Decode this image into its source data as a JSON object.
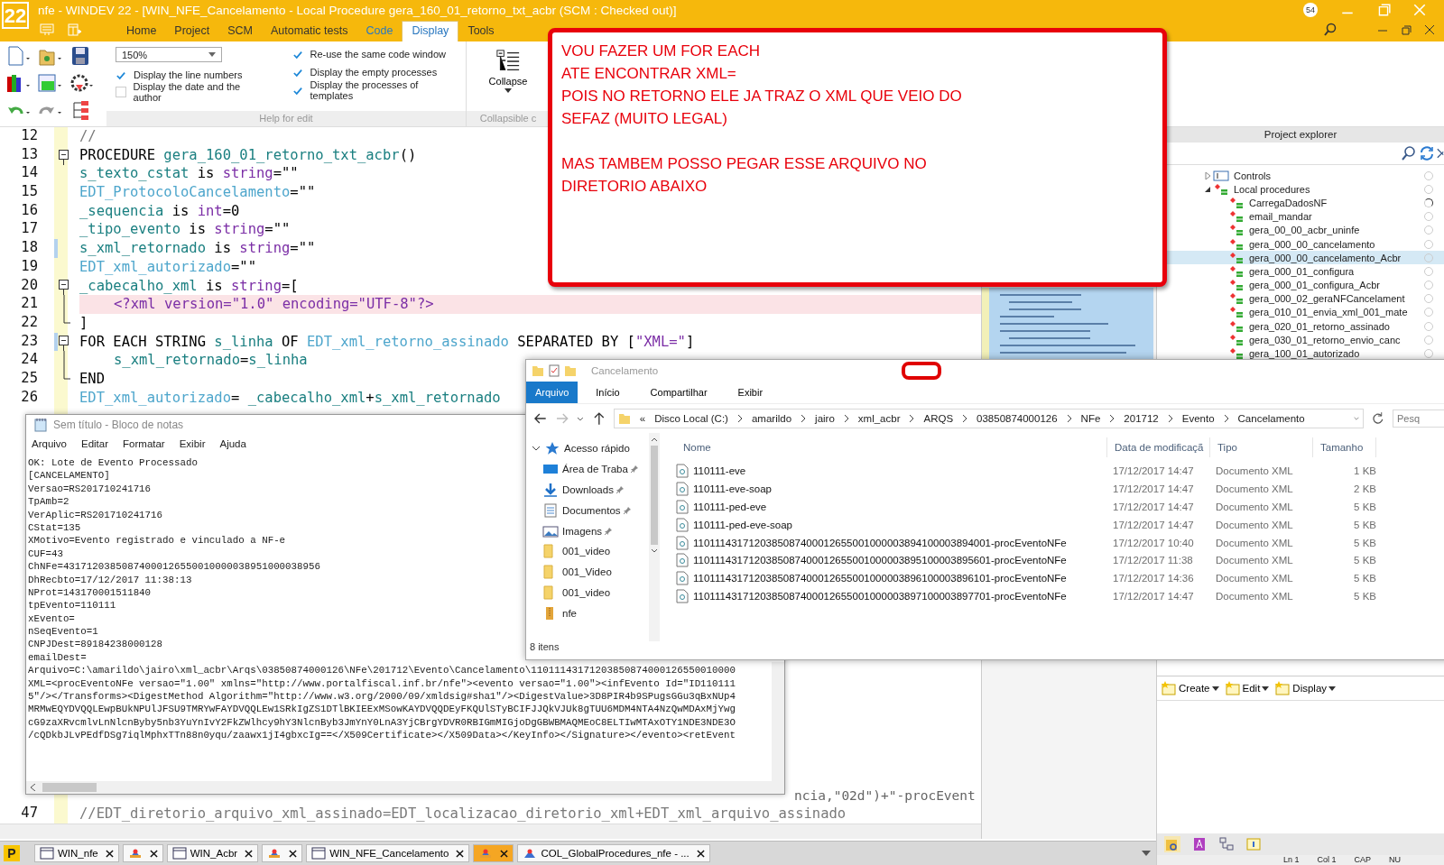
{
  "window": {
    "title": "nfe - WINDEV 22 - [WIN_NFE_Cancelamento - Local Procedure gera_160_01_retorno_txt_acbr (SCM : Checked out)]",
    "logo": "22",
    "notification_count": "54"
  },
  "ribbon_tabs": [
    {
      "label": "Home",
      "selected": false,
      "kind": "normal"
    },
    {
      "label": "Project",
      "selected": false,
      "kind": "normal"
    },
    {
      "label": "SCM",
      "selected": false,
      "kind": "normal"
    },
    {
      "label": "Automatic tests",
      "selected": false,
      "kind": "normal"
    },
    {
      "label": "Code",
      "selected": false,
      "kind": "contextual"
    },
    {
      "label": "Display",
      "selected": true,
      "kind": "normal"
    },
    {
      "label": "Tools",
      "selected": false,
      "kind": "normal"
    }
  ],
  "ribbon": {
    "zoom": "150%",
    "options": [
      {
        "label": "Display the line numbers",
        "checked": true
      },
      {
        "label": "Display the date and the author",
        "checked": false
      },
      {
        "label": "Re-use the same code window",
        "checked": true
      },
      {
        "label": "Display the empty processes",
        "checked": true
      },
      {
        "label": "Display the processes of templates",
        "checked": true
      }
    ],
    "group_label": "Help for edit",
    "collapse_label": "Collapse",
    "group2_label": "Collapsible c"
  },
  "callout": {
    "paragraphs": [
      "VOU FAZER UM FOR EACH\nATE ENCONTRAR XML=\nPOIS NO RETORNO ELE JA TRAZ O XML QUE VEIO DO\nSEFAZ (MUITO LEGAL)",
      "MAS TAMBEM POSSO PEGAR ESSE ARQUIVO NO\nDIRETORIO ABAIXO"
    ]
  },
  "code_editor": {
    "lines": [
      {
        "number": "12",
        "kind": "plain",
        "changed": false,
        "highlighted": false,
        "indent": false,
        "tokens": [
          {
            "text": "//",
            "kind": "comment"
          }
        ]
      },
      {
        "number": "13",
        "kind": "fold_start",
        "changed": false,
        "highlighted": false,
        "indent": false,
        "tokens": [
          {
            "text": "PROCEDURE ",
            "kind": "keyword"
          },
          {
            "text": "gera_160_01_retorno_txt_acbr",
            "kind": "identifier"
          },
          {
            "text": "()",
            "kind": "keyword"
          }
        ]
      },
      {
        "number": "14",
        "kind": "plain",
        "changed": false,
        "highlighted": false,
        "indent": false,
        "tokens": [
          {
            "text": "s_texto_cstat",
            "kind": "identifier"
          },
          {
            "text": " is ",
            "kind": "keyword"
          },
          {
            "text": "string",
            "kind": "type"
          },
          {
            "text": "=\"\"",
            "kind": "keyword"
          }
        ]
      },
      {
        "number": "15",
        "kind": "plain",
        "changed": false,
        "highlighted": false,
        "indent": false,
        "tokens": [
          {
            "text": "EDT_ProtocoloCancelamento",
            "kind": "control"
          },
          {
            "text": "=\"\"",
            "kind": "keyword"
          }
        ]
      },
      {
        "number": "16",
        "kind": "plain",
        "changed": false,
        "highlighted": false,
        "indent": false,
        "tokens": [
          {
            "text": "_sequencia",
            "kind": "identifier"
          },
          {
            "text": " is ",
            "kind": "keyword"
          },
          {
            "text": "int",
            "kind": "type"
          },
          {
            "text": "=0",
            "kind": "keyword"
          }
        ]
      },
      {
        "number": "17",
        "kind": "plain",
        "changed": false,
        "highlighted": false,
        "indent": false,
        "tokens": [
          {
            "text": "_tipo_evento",
            "kind": "identifier"
          },
          {
            "text": " is ",
            "kind": "keyword"
          },
          {
            "text": "string",
            "kind": "type"
          },
          {
            "text": "=\"\"",
            "kind": "keyword"
          }
        ]
      },
      {
        "number": "18",
        "kind": "plain",
        "changed": true,
        "highlighted": false,
        "indent": false,
        "tokens": [
          {
            "text": "s_xml_retornado",
            "kind": "identifier"
          },
          {
            "text": " is ",
            "kind": "keyword"
          },
          {
            "text": "string",
            "kind": "type"
          },
          {
            "text": "=\"\"",
            "kind": "keyword"
          }
        ]
      },
      {
        "number": "19",
        "kind": "plain",
        "changed": false,
        "highlighted": false,
        "indent": false,
        "tokens": [
          {
            "text": "EDT_xml_autorizado",
            "kind": "control"
          },
          {
            "text": "=\"\"",
            "kind": "keyword"
          }
        ]
      },
      {
        "number": "20",
        "kind": "fold_start",
        "changed": false,
        "highlighted": false,
        "indent": false,
        "tokens": [
          {
            "text": "_cabecalho_xml",
            "kind": "identifier"
          },
          {
            "text": " is ",
            "kind": "keyword"
          },
          {
            "text": "string",
            "kind": "type"
          },
          {
            "text": "=[",
            "kind": "keyword"
          }
        ]
      },
      {
        "number": "21",
        "kind": "fold_mid",
        "changed": false,
        "highlighted": true,
        "indent": true,
        "tokens": [
          {
            "text": "<?xml version=\"1.0\" encoding=\"UTF-8\"?>",
            "kind": "string"
          }
        ]
      },
      {
        "number": "22",
        "kind": "fold_end",
        "changed": false,
        "highlighted": false,
        "indent": false,
        "tokens": [
          {
            "text": "]",
            "kind": "keyword"
          }
        ]
      },
      {
        "number": "23",
        "kind": "fold_start",
        "changed": true,
        "highlighted": false,
        "indent": false,
        "tokens": [
          {
            "text": "FOR EACH STRING ",
            "kind": "keyword"
          },
          {
            "text": "s_linha",
            "kind": "identifier"
          },
          {
            "text": " OF ",
            "kind": "keyword"
          },
          {
            "text": "EDT_xml_retorno_assinado",
            "kind": "control"
          },
          {
            "text": " SEPARATED BY [",
            "kind": "keyword"
          },
          {
            "text": "\"XML=\"",
            "kind": "string"
          },
          {
            "text": "]",
            "kind": "keyword"
          }
        ]
      },
      {
        "number": "24",
        "kind": "fold_mid",
        "changed": false,
        "highlighted": false,
        "indent": true,
        "tokens": [
          {
            "text": "s_xml_retornado",
            "kind": "identifier"
          },
          {
            "text": "=",
            "kind": "keyword"
          },
          {
            "text": "s_linha",
            "kind": "identifier"
          }
        ]
      },
      {
        "number": "25",
        "kind": "fold_end",
        "changed": false,
        "highlighted": false,
        "indent": false,
        "tokens": [
          {
            "text": "END",
            "kind": "keyword"
          }
        ]
      },
      {
        "number": "26",
        "kind": "plain",
        "changed": false,
        "highlighted": false,
        "indent": false,
        "tokens": [
          {
            "text": "EDT_xml_autorizado",
            "kind": "control"
          },
          {
            "text": "= ",
            "kind": "keyword"
          },
          {
            "text": "_cabecalho_xml",
            "kind": "identifier"
          },
          {
            "text": "+",
            "kind": "keyword"
          },
          {
            "text": "s_xml_retornado",
            "kind": "identifier"
          }
        ]
      }
    ],
    "partial_line": "ncia,\"02d\")+\"-procEvent",
    "bottom_lines": [
      {
        "number": "47",
        "changed": false,
        "highlighted": false,
        "indent": false,
        "tokens": [
          {
            "text": "//EDT_diretorio_arquivo_xml_assinado=EDT_localizacao_diretorio_xml+EDT_xml_arquivo_assinado",
            "kind": "comment"
          }
        ]
      }
    ]
  },
  "project_explorer": {
    "title": "Project explorer",
    "tree": [
      {
        "label": "Controls",
        "expanded": false,
        "kind": "controls",
        "marked": false
      },
      {
        "label": "Local procedures",
        "expanded": true,
        "kind": "procedures",
        "marked": false,
        "children": [
          {
            "label": "CarregaDadosNF",
            "selected": false,
            "marked": true
          },
          {
            "label": "email_mandar",
            "selected": false,
            "marked": false
          },
          {
            "label": "gera_00_00_acbr_uninfe",
            "selected": false,
            "marked": false
          },
          {
            "label": "gera_000_00_cancelamento",
            "selected": false,
            "marked": false
          },
          {
            "label": "gera_000_00_cancelamento_Acbr",
            "selected": true,
            "marked": false
          },
          {
            "label": "gera_000_01_configura",
            "selected": false,
            "marked": false
          },
          {
            "label": "gera_000_01_configura_Acbr",
            "selected": false,
            "marked": false
          },
          {
            "label": "gera_000_02_geraNFCancelament",
            "selected": false,
            "marked": false
          },
          {
            "label": "gera_010_01_envia_xml_001_mate",
            "selected": false,
            "marked": false
          },
          {
            "label": "gera_020_01_retorno_assinado",
            "selected": false,
            "marked": false
          },
          {
            "label": "gera_030_01_retorno_envio_canc",
            "selected": false,
            "marked": false
          },
          {
            "label": "gera_100_01_autorizado",
            "selected": false,
            "marked": false
          }
        ]
      }
    ]
  },
  "notepad": {
    "title": "Sem título - Bloco de notas",
    "menu": [
      "Arquivo",
      "Editar",
      "Formatar",
      "Exibir",
      "Ajuda"
    ],
    "lines": [
      "OK: Lote de Evento Processado",
      "[CANCELAMENTO]",
      "Versao=RS201710241716",
      "TpAmb=2",
      "VerAplic=RS201710241716",
      "CStat=135",
      "XMotivo=Evento registrado e vinculado a NF-e",
      "CUF=43",
      "ChNFe=43171203850874000126550010000038951000038956",
      "DhRecbto=17/12/2017 11:38:13",
      "NProt=143170001511840",
      "tpEvento=110111",
      "xEvento=",
      "nSeqEvento=1",
      "CNPJDest=89184238000128",
      "emailDest=",
      "Arquivo=C:\\amarildo\\jairo\\xml_acbr\\Arqs\\03850874000126\\NFe\\201712\\Evento\\Cancelamento\\11011143171203850874000126550010000",
      "XML=<procEventoNFe versao=\"1.00\" xmlns=\"http://www.portalfiscal.inf.br/nfe\"><evento versao=\"1.00\"><infEvento Id=\"ID110111",
      "5\"/></Transforms><DigestMethod Algorithm=\"http://www.w3.org/2000/09/xmldsig#sha1\"/><DigestValue>3D8PIR4b9SPugsGGu3qBxNUp4",
      "MRMwEQYDVQQLEwpBUkNPUlJFSU9TMRYwFAYDVQQLEw1SRkIgZS1DTlBKIEExMSowKAYDVQQDEyFKQUlSTyBCIFJJQkVJUk8gTUU6MDM4NTA4NzQwMDAxMjYwg",
      "cG9zaXRvcmlvLnNlcnByby5nb3YuYnIvY2FkZWlhcy9hY3NlcnByb3JmYnY0LnA3YjCBrgYDVR0RBIGmMIGjoDgGBWBMAQMEoC8ELTIwMTAxOTY1NDE3NDE3O",
      "/cQDkbJLvPEdfDSg7iqlMphxTTn88n0yqu/zaawx1jI4gbxcIg==</X509Certificate></X509Data></KeyInfo></Signature></evento><retEvent"
    ]
  },
  "file_explorer": {
    "title": "Cancelamento",
    "tabs": [
      {
        "label": "Arquivo",
        "selected": true
      },
      {
        "label": "Início",
        "selected": false
      },
      {
        "label": "Compartilhar",
        "selected": false
      },
      {
        "label": "Exibir",
        "selected": false
      }
    ],
    "path": [
      "«",
      "Disco Local (C:)",
      "amarildo",
      "jairo",
      "xml_acbr",
      "ARQS",
      "03850874000126",
      "NFe",
      "201712",
      "Evento",
      "Cancelamento"
    ],
    "search_placeholder": "Pesq",
    "nav": [
      {
        "label": "Acesso rápido",
        "kind": "quick",
        "pinned": false
      },
      {
        "label": "Área de Traba",
        "kind": "desktop",
        "pinned": true
      },
      {
        "label": "Downloads",
        "kind": "downloads",
        "pinned": true
      },
      {
        "label": "Documentos",
        "kind": "documents",
        "pinned": true
      },
      {
        "label": "Imagens",
        "kind": "pictures",
        "pinned": true
      },
      {
        "label": "001_video",
        "kind": "folder",
        "pinned": false
      },
      {
        "label": "001_Video",
        "kind": "folder",
        "pinned": false
      },
      {
        "label": "001_video",
        "kind": "folder",
        "pinned": false
      },
      {
        "label": "nfe",
        "kind": "archive",
        "pinned": false
      }
    ],
    "columns": [
      "Nome",
      "Data de modificaçã",
      "Tipo",
      "Tamanho"
    ],
    "files": [
      {
        "name": "110111-eve",
        "modified": "17/12/2017 14:47",
        "type": "Documento XML",
        "size": "1 KB"
      },
      {
        "name": "110111-eve-soap",
        "modified": "17/12/2017 14:47",
        "type": "Documento XML",
        "size": "2 KB"
      },
      {
        "name": "110111-ped-eve",
        "modified": "17/12/2017 14:47",
        "type": "Documento XML",
        "size": "5 KB"
      },
      {
        "name": "110111-ped-eve-soap",
        "modified": "17/12/2017 14:47",
        "type": "Documento XML",
        "size": "5 KB"
      },
      {
        "name": "1101114317120385087400012655001000003894100003894001-procEventoNFe",
        "modified": "17/12/2017 10:40",
        "type": "Documento XML",
        "size": "5 KB"
      },
      {
        "name": "1101114317120385087400012655001000003895100003895601-procEventoNFe",
        "modified": "17/12/2017 11:38",
        "type": "Documento XML",
        "size": "5 KB"
      },
      {
        "name": "1101114317120385087400012655001000003896100003896101-procEventoNFe",
        "modified": "17/12/2017 14:36",
        "type": "Documento XML",
        "size": "5 KB"
      },
      {
        "name": "1101114317120385087400012655001000003897100003897701-procEventoNFe",
        "modified": "17/12/2017 14:47",
        "type": "Documento XML",
        "size": "5 KB"
      }
    ],
    "status": "8 itens"
  },
  "panel_toolbar": [
    "Create",
    "Edit",
    "Display"
  ],
  "document_tabs": [
    {
      "label": "WIN_nfe",
      "kind": "window",
      "selected": false
    },
    {
      "kind": "query",
      "selected": false
    },
    {
      "label": "WIN_Acbr",
      "kind": "window",
      "selected": false
    },
    {
      "kind": "query",
      "selected": false
    },
    {
      "label": "WIN_NFE_Cancelamento",
      "kind": "window",
      "selected": false
    },
    {
      "kind": "query",
      "selected": true
    },
    {
      "label": "COL_GlobalProcedures_nfe - ...",
      "kind": "collection",
      "selected": false
    }
  ],
  "project_letter": "P",
  "status_bar": [
    "Ln 1",
    "Col 1",
    "CAP",
    "NU"
  ]
}
